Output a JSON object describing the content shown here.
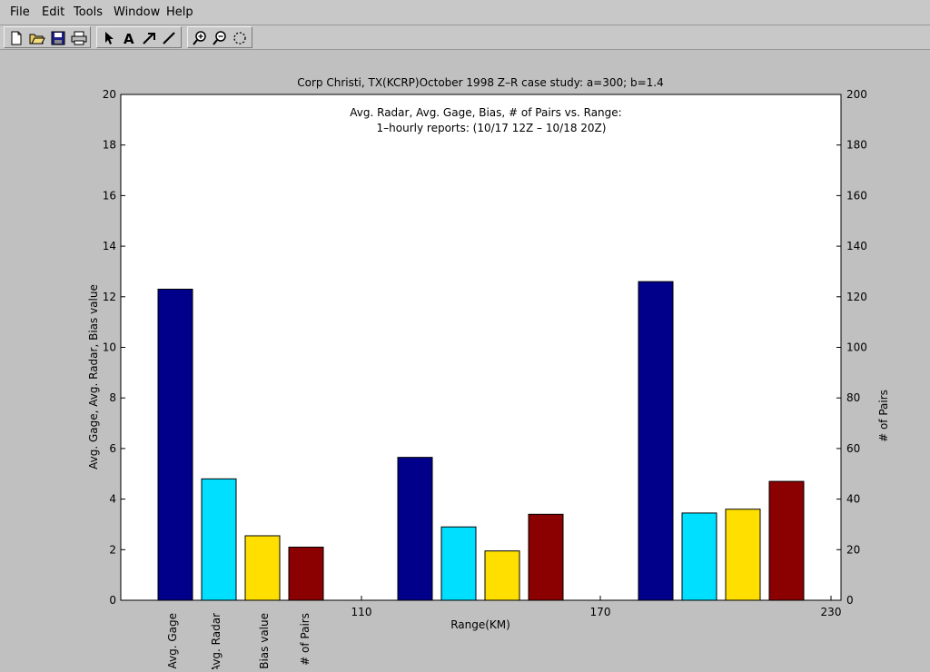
{
  "menu": {
    "file": "File",
    "edit": "Edit",
    "tools": "Tools",
    "window": "Window",
    "help": "Help"
  },
  "toolbar": {
    "icons": [
      "new-file-icon",
      "open-folder-icon",
      "save-icon",
      "print-icon",
      "select-arrow-icon",
      "text-icon",
      "arrow-tool-icon",
      "line-tool-icon",
      "zoom-in-icon",
      "zoom-out-icon",
      "rotate-icon"
    ]
  },
  "chart_data": {
    "type": "bar",
    "title": "Corp Christi, TX(KCRP)October 1998 Z–R case study: a=300; b=1.4",
    "subtitle_lines": [
      "Avg. Radar, Avg. Gage, Bias, # of Pairs vs. Range:",
      "1–hourly reports: (10/17 12Z – 10/18 20Z)"
    ],
    "xlabel": "Range(KM)",
    "ylabel_left": "Avg. Gage, Avg. Radar, Bias value",
    "ylabel_right": "# of Pairs",
    "x_ticks": [
      "110",
      "170",
      "230"
    ],
    "ylim_left": [
      0,
      20
    ],
    "ylim_right": [
      0,
      200
    ],
    "y_ticks_left": [
      "0",
      "2",
      "4",
      "6",
      "8",
      "10",
      "12",
      "14",
      "16",
      "18",
      "20"
    ],
    "y_ticks_right": [
      "0",
      "20",
      "40",
      "60",
      "80",
      "100",
      "120",
      "140",
      "160",
      "180",
      "200"
    ],
    "legend_labels": [
      "Avg. Gage",
      "Avg. Radar",
      "Bias value",
      "# of Pairs"
    ],
    "series_colors": [
      "#00008b",
      "#00dfff",
      "#ffdf00",
      "#8b0000"
    ],
    "groups": [
      {
        "values": [
          12.3,
          4.8,
          2.55,
          2.1
        ]
      },
      {
        "values": [
          5.65,
          2.9,
          1.95,
          3.4
        ]
      },
      {
        "values": [
          12.6,
          3.45,
          3.6,
          4.7
        ]
      }
    ],
    "grid": false
  }
}
